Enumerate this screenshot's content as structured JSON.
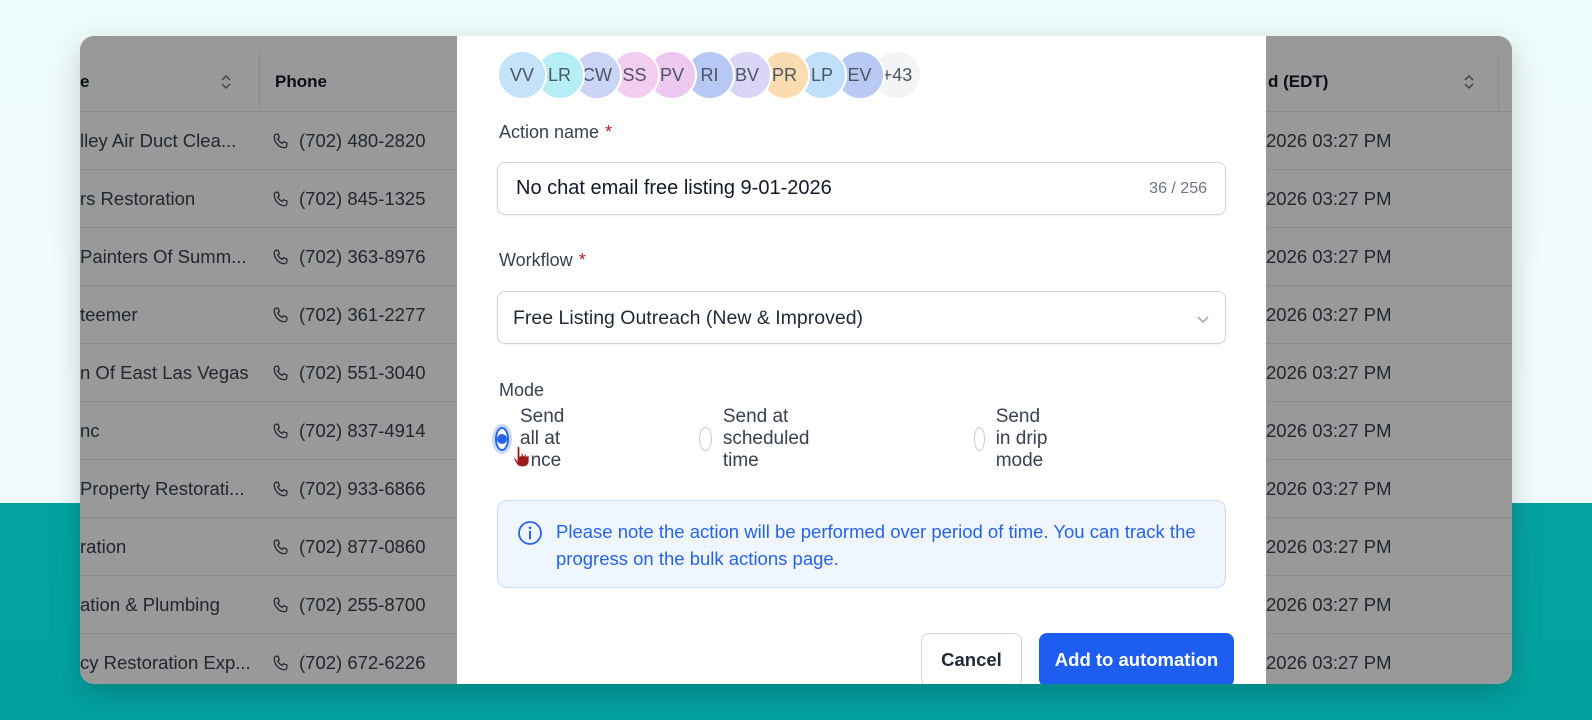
{
  "table": {
    "headers": {
      "name": "e",
      "phone": "Phone",
      "date": "d (EDT)"
    },
    "rows": [
      {
        "name": "lley Air Duct Clea...",
        "phone": "(702) 480-2820",
        "date": "2026 03:27 PM"
      },
      {
        "name": "rs Restoration",
        "phone": "(702) 845-1325",
        "date": "2026 03:27 PM"
      },
      {
        "name": " Painters Of Summ...",
        "phone": "(702) 363-8976",
        "date": "2026 03:27 PM"
      },
      {
        "name": "teemer",
        "phone": "(702) 361-2277",
        "date": "2026 03:27 PM"
      },
      {
        "name": "n Of East Las Vegas",
        "phone": "(702) 551-3040",
        "date": "2026 03:27 PM"
      },
      {
        "name": "nc",
        "phone": "(702) 837-4914",
        "date": "2026 03:27 PM"
      },
      {
        "name": "Property Restorati...",
        "phone": "(702) 933-6866",
        "date": "2026 03:27 PM"
      },
      {
        "name": "ration",
        "phone": "(702) 877-0860",
        "date": "2026 03:27 PM"
      },
      {
        "name": "ation & Plumbing",
        "phone": "(702) 255-8700",
        "date": "2026 03:27 PM"
      },
      {
        "name": "cy Restoration Exp...",
        "phone": "(702) 672-6226",
        "date": "2026 03:27 PM"
      }
    ]
  },
  "modal": {
    "avatars": [
      {
        "initials": "VV",
        "color": "#c4e3f9"
      },
      {
        "initials": "LR",
        "color": "#b5eef5"
      },
      {
        "initials": "CW",
        "color": "#cad4f6"
      },
      {
        "initials": "SS",
        "color": "#f3cdf0"
      },
      {
        "initials": "PV",
        "color": "#edc9f2"
      },
      {
        "initials": "RI",
        "color": "#b6c8f3"
      },
      {
        "initials": "BV",
        "color": "#d9d5f7"
      },
      {
        "initials": "PR",
        "color": "#fbdcb0"
      },
      {
        "initials": "LP",
        "color": "#bfe0f8"
      },
      {
        "initials": "EV",
        "color": "#b8c9f4"
      },
      {
        "initials": "+43",
        "color": "#f3f4f6"
      }
    ],
    "action_name": {
      "label": "Action name",
      "required_mark": "*",
      "value": "No chat email free listing 9-01-2026",
      "count": "36 / 256"
    },
    "workflow": {
      "label": "Workflow",
      "required_mark": "*",
      "selected": "Free Listing Outreach (New & Improved)"
    },
    "mode": {
      "label": "Mode",
      "options": [
        {
          "label": "Send all at once",
          "checked": true
        },
        {
          "label": "Send at scheduled time",
          "checked": false
        },
        {
          "label": "Send in drip mode",
          "checked": false
        }
      ]
    },
    "info": {
      "text": "Please note the action will be performed over period of time. You can track the progress on the bulk actions page."
    },
    "buttons": {
      "cancel": "Cancel",
      "submit": "Add to automation"
    }
  },
  "colors": {
    "accent": "#1d5ef0",
    "info_text": "#2563eb",
    "backdrop_bottom": "#04a3a1"
  }
}
